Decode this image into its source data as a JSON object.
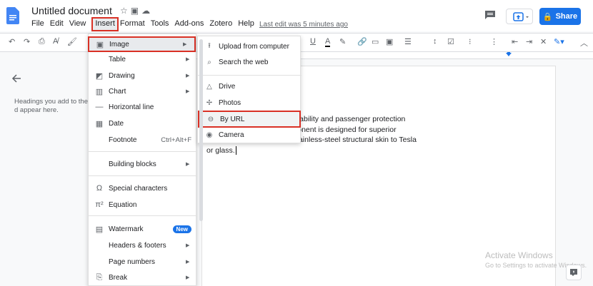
{
  "doc": {
    "title": "Untitled document",
    "last_edit": "Last edit was 5 minutes ago"
  },
  "menubar": [
    "File",
    "Edit",
    "View",
    "Insert",
    "Format",
    "Tools",
    "Add-ons",
    "Zotero",
    "Help"
  ],
  "share": {
    "label": "Share"
  },
  "outline": {
    "hint": "Headings you add to the d appear here."
  },
  "document_text": {
    "line1": "r shell made for ultimate durability and passenger protection",
    "line2": "le exoskeleton, every component is designed for superior",
    "line3": "tra-Hard 30X Cold-Rolled stainless-steel structural skin to Tesla",
    "line4": "or glass."
  },
  "insert_menu": {
    "image": "Image",
    "table": "Table",
    "drawing": "Drawing",
    "chart": "Chart",
    "horizontal_line": "Horizontal line",
    "date": "Date",
    "footnote": "Footnote",
    "footnote_shortcut": "Ctrl+Alt+F",
    "building_blocks": "Building blocks",
    "special_characters": "Special characters",
    "equation": "Equation",
    "watermark": "Watermark",
    "watermark_badge": "New",
    "headers_footers": "Headers & footers",
    "page_numbers": "Page numbers",
    "break": "Break"
  },
  "image_submenu": {
    "upload": "Upload from computer",
    "search": "Search the web",
    "drive": "Drive",
    "photos": "Photos",
    "by_url": "By URL",
    "camera": "Camera"
  },
  "windows": {
    "title": "Activate Windows",
    "sub": "Go to Settings to activate Windows."
  },
  "colors": {
    "accent": "#1a73e8",
    "highlight_border": "#d93025"
  }
}
